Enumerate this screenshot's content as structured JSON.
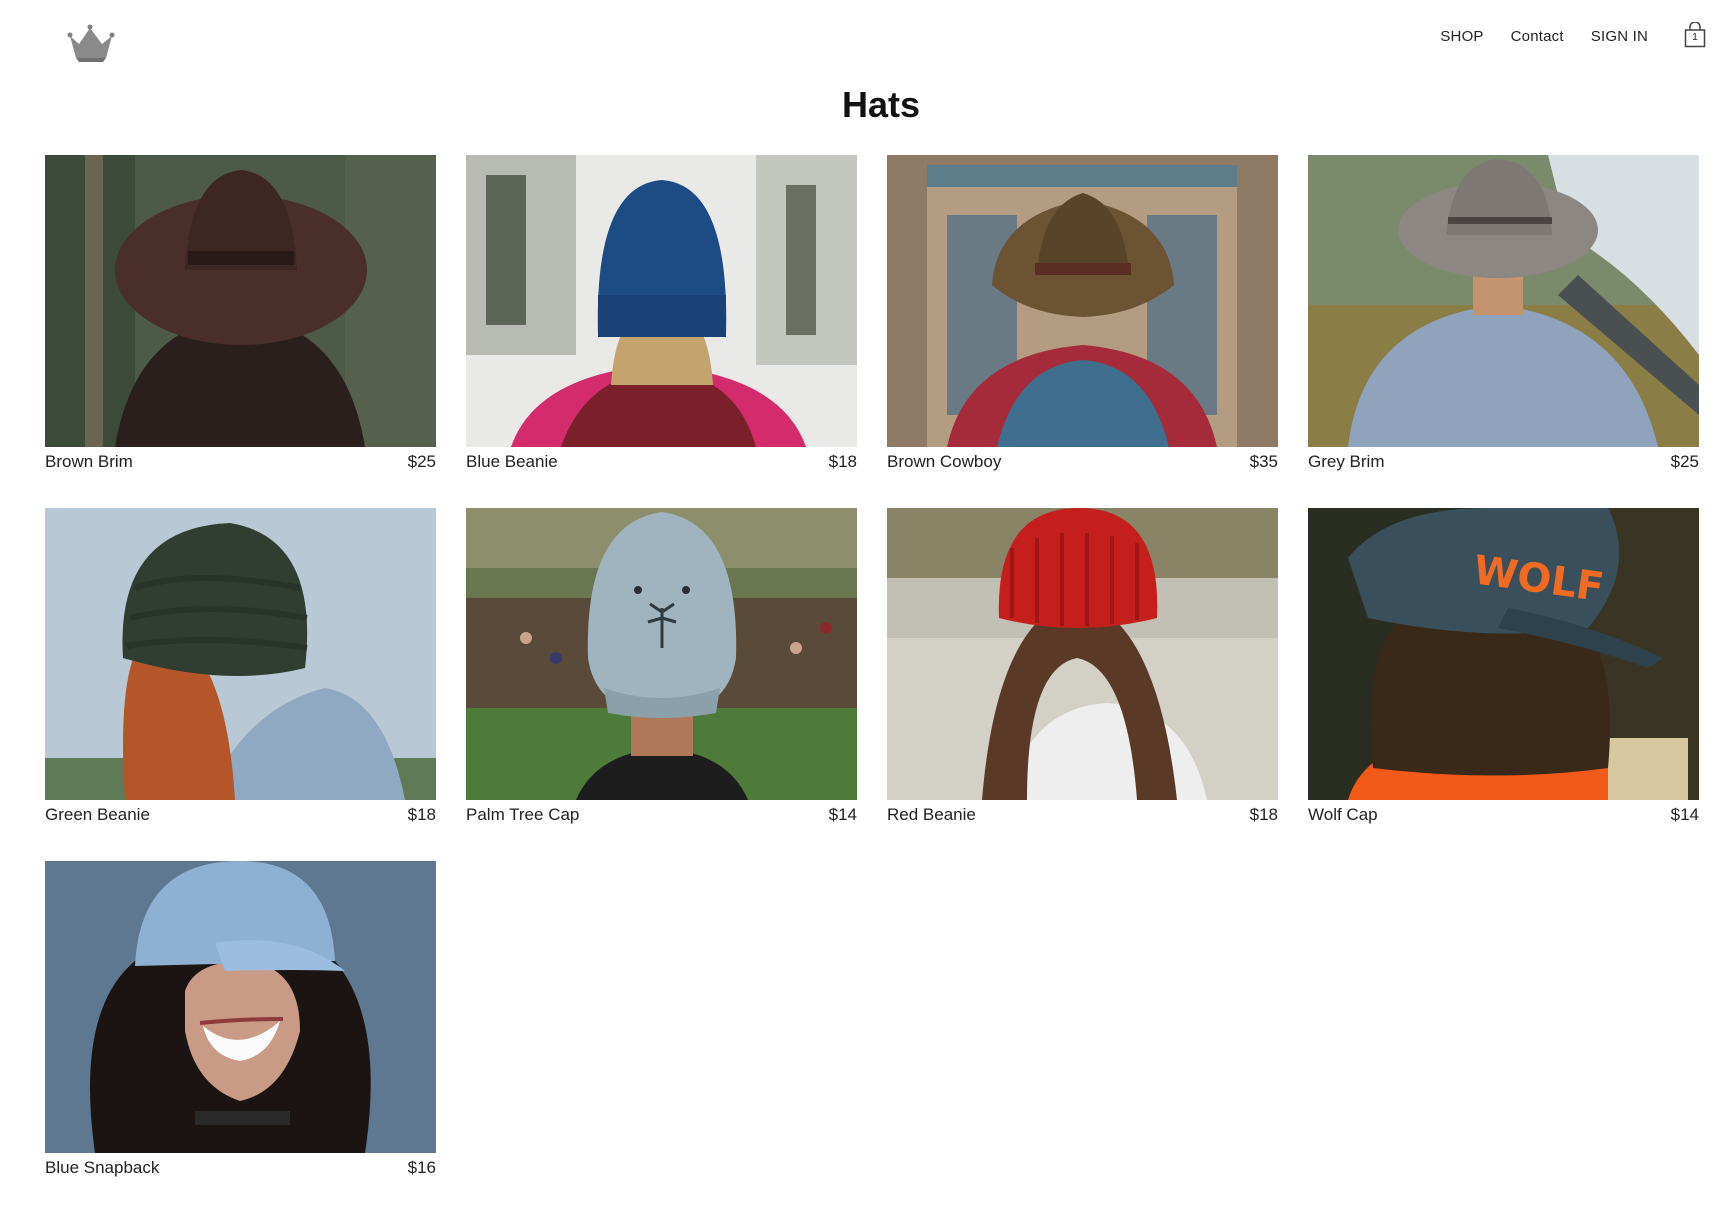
{
  "header": {
    "logo_icon": "crown-icon",
    "nav": [
      {
        "label": "SHOP"
      },
      {
        "label": "Contact"
      },
      {
        "label": "SIGN IN"
      }
    ],
    "cart": {
      "icon": "shopping-bag-icon",
      "count": "1"
    }
  },
  "page": {
    "title": "Hats"
  },
  "products": [
    {
      "name": "Brown Brim",
      "price": "$25"
    },
    {
      "name": "Blue Beanie",
      "price": "$18"
    },
    {
      "name": "Brown Cowboy",
      "price": "$35"
    },
    {
      "name": "Grey Brim",
      "price": "$25"
    },
    {
      "name": "Green Beanie",
      "price": "$18"
    },
    {
      "name": "Palm Tree Cap",
      "price": "$14"
    },
    {
      "name": "Red Beanie",
      "price": "$18"
    },
    {
      "name": "Wolf Cap",
      "price": "$14"
    },
    {
      "name": "Blue Snapback",
      "price": "$16"
    }
  ]
}
